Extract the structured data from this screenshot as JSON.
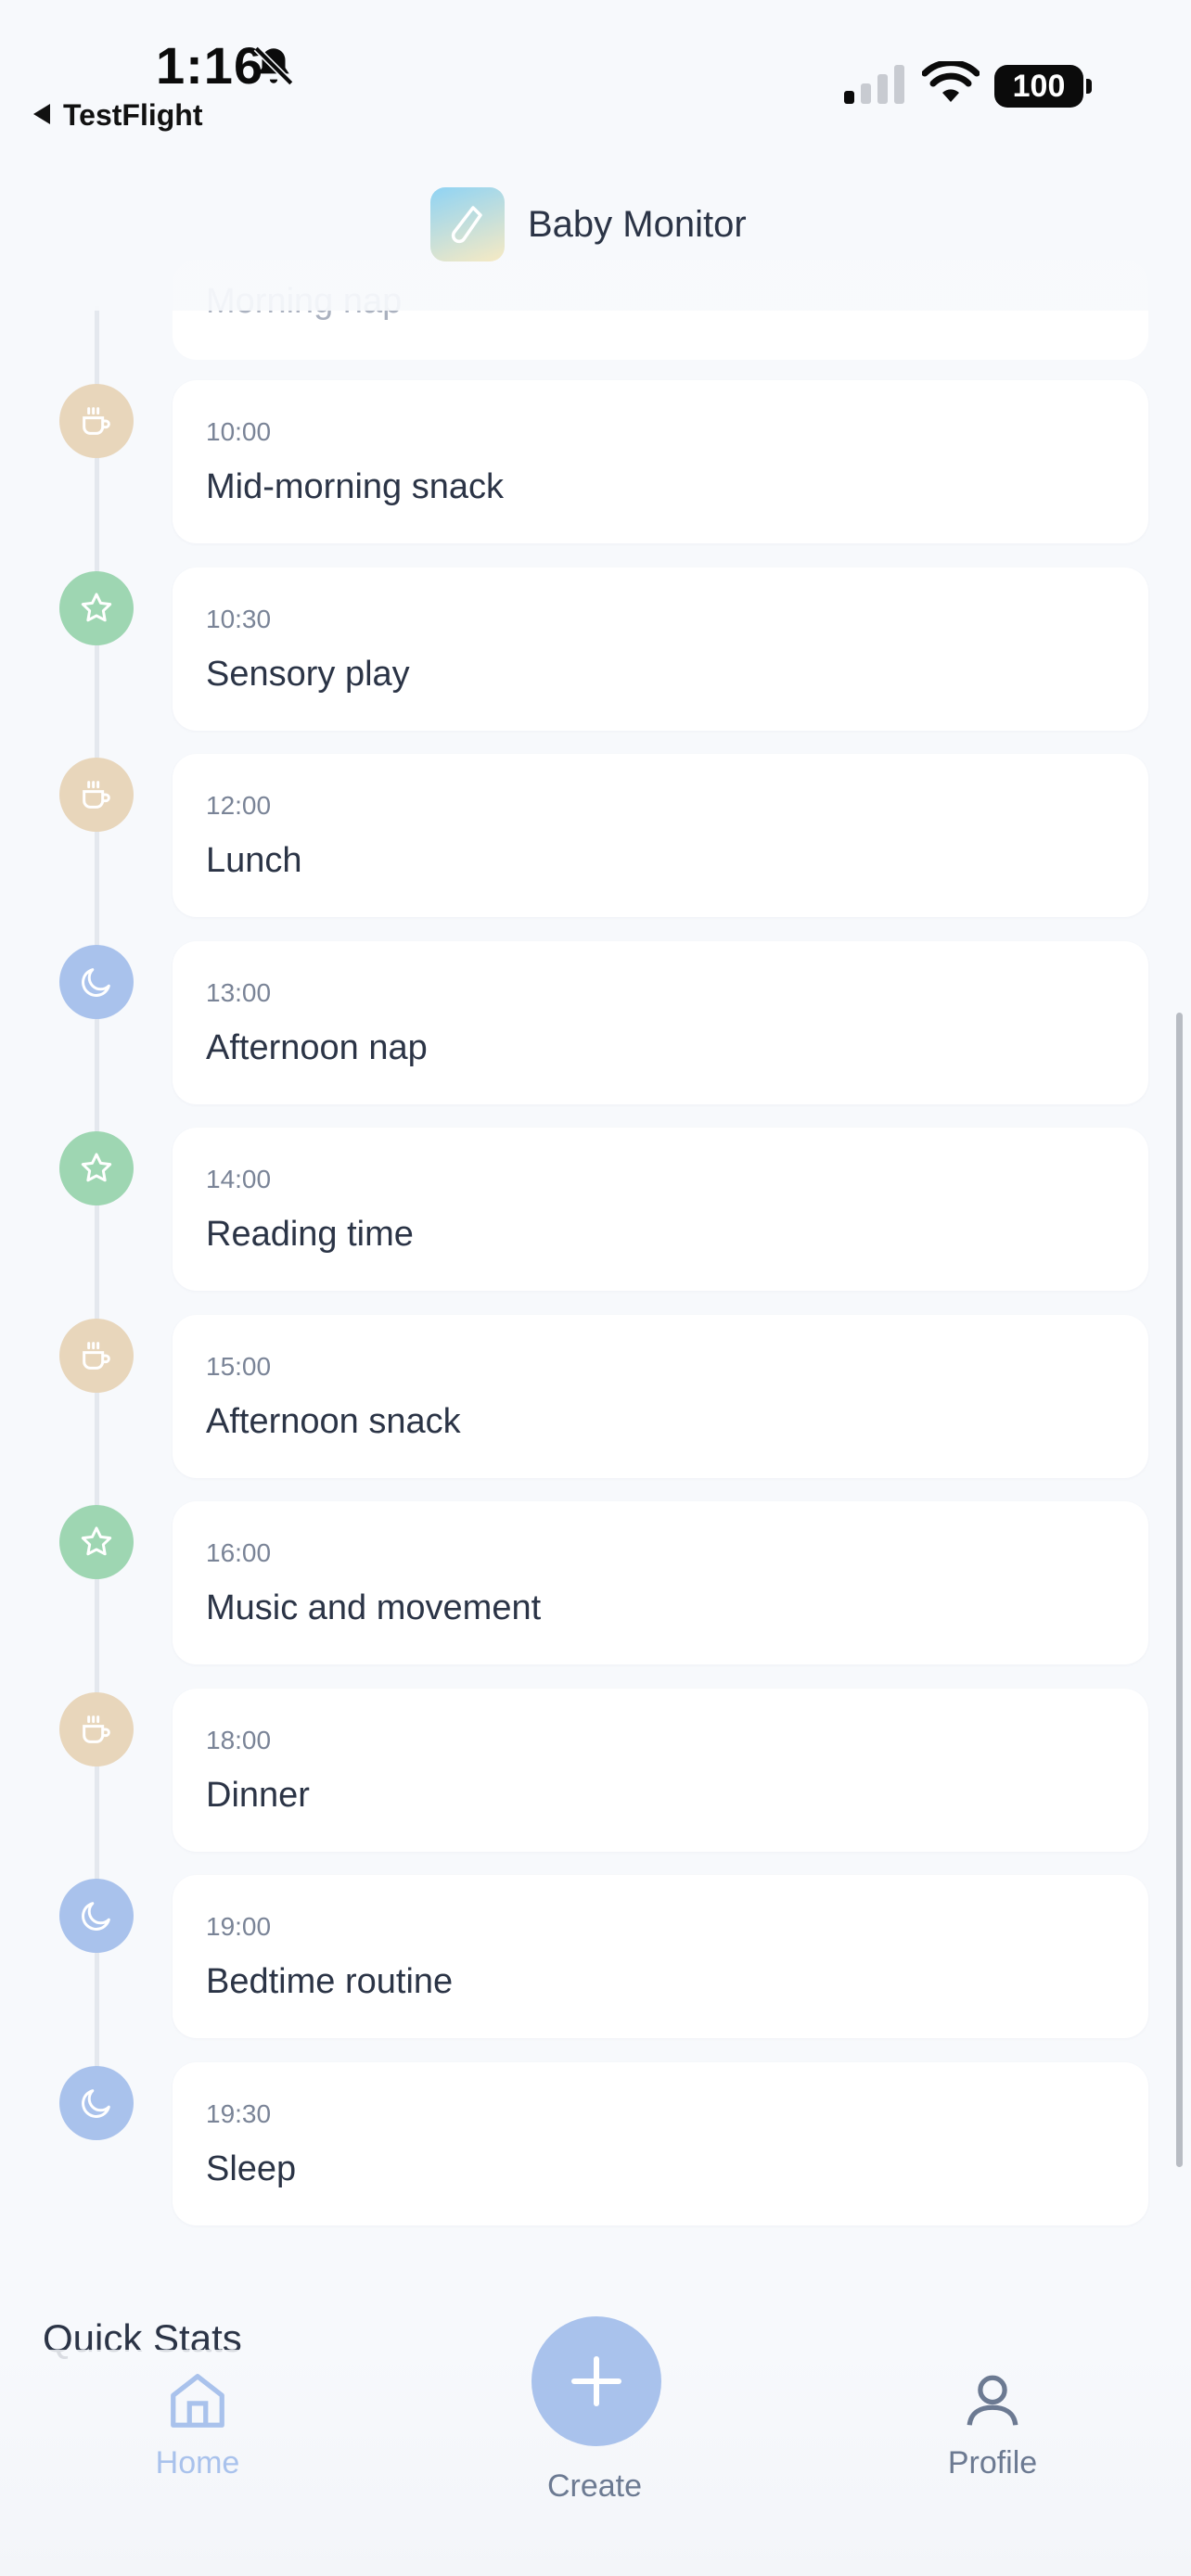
{
  "status_bar": {
    "time": "1:16",
    "back_app": "TestFlight",
    "battery": "100"
  },
  "header": {
    "title": "Baby Monitor"
  },
  "timeline": {
    "partial_item_label": "Morning nap",
    "items": [
      {
        "time": "10:00",
        "label": "Mid-morning snack",
        "type": "meal",
        "icon": "coffee-icon"
      },
      {
        "time": "10:30",
        "label": "Sensory play",
        "type": "play",
        "icon": "star-icon"
      },
      {
        "time": "12:00",
        "label": "Lunch",
        "type": "meal",
        "icon": "coffee-icon"
      },
      {
        "time": "13:00",
        "label": "Afternoon nap",
        "type": "sleep",
        "icon": "moon-icon"
      },
      {
        "time": "14:00",
        "label": "Reading time",
        "type": "play",
        "icon": "star-icon"
      },
      {
        "time": "15:00",
        "label": "Afternoon snack",
        "type": "meal",
        "icon": "coffee-icon"
      },
      {
        "time": "16:00",
        "label": "Music and movement",
        "type": "play",
        "icon": "star-icon"
      },
      {
        "time": "18:00",
        "label": "Dinner",
        "type": "meal",
        "icon": "coffee-icon"
      },
      {
        "time": "19:00",
        "label": "Bedtime routine",
        "type": "sleep",
        "icon": "moon-icon"
      },
      {
        "time": "19:30",
        "label": "Sleep",
        "type": "sleep",
        "icon": "moon-icon"
      }
    ]
  },
  "section": {
    "quick_stats": "Quick Stats"
  },
  "tabbar": {
    "home": "Home",
    "create": "Create",
    "profile": "Profile"
  },
  "colors": {
    "meal": "#e8d6bb",
    "play": "#9ed6b2",
    "sleep": "#a9c2ec",
    "active_tab": "#a9c2ec",
    "text": "#2b3446"
  }
}
